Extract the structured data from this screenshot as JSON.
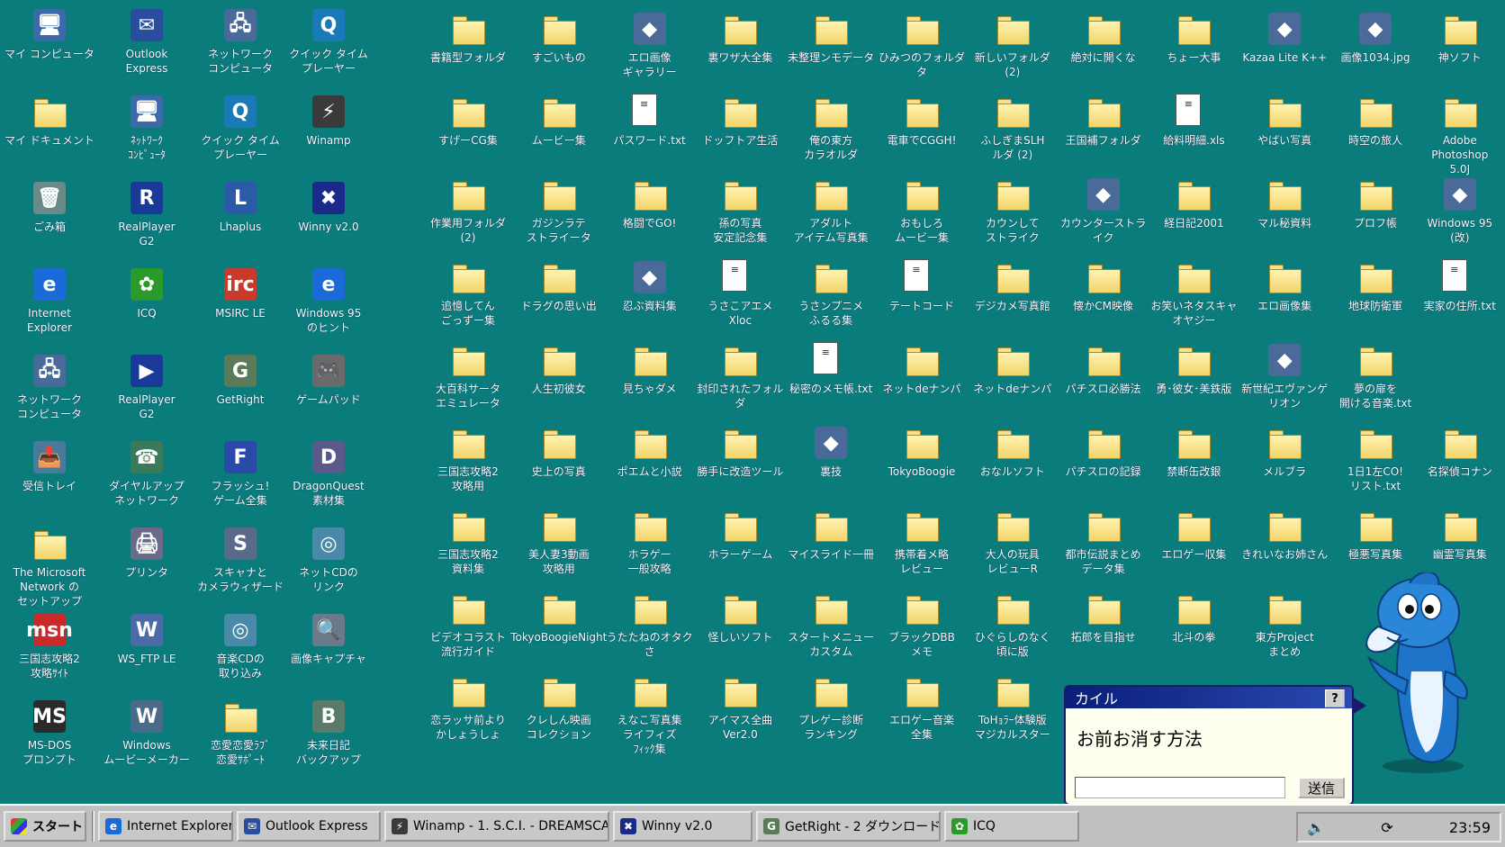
{
  "left_icons": [
    {
      "label": "マイ コンピュータ",
      "glyph": "🖥",
      "kind": "app",
      "color": "#3a6aa8"
    },
    {
      "label": "Outlook\nExpress",
      "glyph": "✉",
      "kind": "app",
      "color": "#2a4e9e"
    },
    {
      "label": "ネットワーク\nコンピュータ",
      "glyph": "🖧",
      "kind": "app",
      "color": "#4a6a9a"
    },
    {
      "label": "クイック タイム\nプレーヤー",
      "glyph": "Q",
      "kind": "app",
      "color": "#1a7ab8"
    },
    {
      "label": "マイ ドキュメント",
      "glyph": "",
      "kind": "folder"
    },
    {
      "label": "ﾈｯﾄﾜｰｸ\nｺﾝﾋﾟｭｰﾀ",
      "glyph": "🖥",
      "kind": "app",
      "color": "#3a6aa8"
    },
    {
      "label": "クイック タイム\nプレーヤー",
      "glyph": "Q",
      "kind": "app",
      "color": "#1a7ab8"
    },
    {
      "label": "Winamp",
      "glyph": "⚡",
      "kind": "app",
      "color": "#3a3a3a"
    },
    {
      "label": "ごみ箱",
      "glyph": "🗑",
      "kind": "app",
      "color": "#6a8a8a"
    },
    {
      "label": "RealPlayer\nG2",
      "glyph": "R",
      "kind": "app",
      "color": "#1a3a9a"
    },
    {
      "label": "Lhaplus",
      "glyph": "L",
      "kind": "app",
      "color": "#2a5aa8"
    },
    {
      "label": "Winny v2.0",
      "glyph": "✖",
      "kind": "app",
      "color": "#1a2a8a"
    },
    {
      "label": "Internet\nExplorer",
      "glyph": "e",
      "kind": "app",
      "color": "#1a6ad8"
    },
    {
      "label": "ICQ",
      "glyph": "✿",
      "kind": "app",
      "color": "#2a9a2a"
    },
    {
      "label": "MSIRC LE",
      "glyph": "irc",
      "kind": "app",
      "color": "#c83a2a"
    },
    {
      "label": "Windows 95\nのヒント",
      "glyph": "e",
      "kind": "app",
      "color": "#1a6ad8"
    },
    {
      "label": "ネットワーク\nコンピュータ",
      "glyph": "🖧",
      "kind": "app",
      "color": "#4a6a9a"
    },
    {
      "label": "RealPlayer\nG2",
      "glyph": "▶",
      "kind": "app",
      "color": "#1a3a9a"
    },
    {
      "label": "GetRight",
      "glyph": "G",
      "kind": "app",
      "color": "#5a7a5a"
    },
    {
      "label": "ゲームパッド",
      "glyph": "🎮",
      "kind": "app",
      "color": "#6a6a6a"
    },
    {
      "label": "受信トレイ",
      "glyph": "📥",
      "kind": "app",
      "color": "#4a7a9a"
    },
    {
      "label": "ダイヤルアップ\nネットワーク",
      "glyph": "☎",
      "kind": "app",
      "color": "#3a7a5a"
    },
    {
      "label": "フラッシュ!\nゲーム全集",
      "glyph": "F",
      "kind": "app",
      "color": "#2a4aa8"
    },
    {
      "label": "DragonQuest\n素材集",
      "glyph": "D",
      "kind": "app",
      "color": "#5a5a8a"
    },
    {
      "label": "The Microsoft\nNetwork の\nセットアップ",
      "glyph": "",
      "kind": "folder"
    },
    {
      "label": "プリンタ",
      "glyph": "🖨",
      "kind": "app",
      "color": "#6a6a8a"
    },
    {
      "label": "スキャナと\nカメラウィザード",
      "glyph": "S",
      "kind": "app",
      "color": "#5a6a8a"
    },
    {
      "label": "ネットCDの\nリンク",
      "glyph": "◎",
      "kind": "app",
      "color": "#4a8aa8"
    },
    {
      "label": "三国志攻略2\n攻略ｻｲﾄ",
      "glyph": "msn",
      "kind": "app",
      "color": "#c82a2a"
    },
    {
      "label": "WS_FTP LE",
      "glyph": "W",
      "kind": "app",
      "color": "#4a6aa8"
    },
    {
      "label": "音楽CDの\n取り込み",
      "glyph": "◎",
      "kind": "app",
      "color": "#4a8aa8"
    },
    {
      "label": "画像キャプチャ",
      "glyph": "🔍",
      "kind": "app",
      "color": "#6a7a8a"
    },
    {
      "label": "MS-DOS\nプロンプト",
      "glyph": "MS",
      "kind": "app",
      "color": "#2a2a2a"
    },
    {
      "label": "Windows\nムービーメーカー",
      "glyph": "W",
      "kind": "app",
      "color": "#4a6a8a"
    },
    {
      "label": "恋愛恋愛ﾗﾌﾞ\n恋愛ｻﾎﾟｰﾄ",
      "glyph": "",
      "kind": "folder"
    },
    {
      "label": "未来日記\nバックアップ",
      "glyph": "B",
      "kind": "app",
      "color": "#5a7a6a"
    }
  ],
  "grid_icons": [
    [
      "書籍型フォルダ",
      "すごいもの",
      "エロ画像\nギャラリー",
      "裏ワザ大全集",
      "未整理ンモデータ",
      "ひみつのフォルダ\nタ",
      "新しいフォルダ\n(2)",
      "絶対に開くな",
      "ちょー大事",
      "Kazaa Lite K++",
      "画像1034.jpg",
      "神ソフト"
    ],
    [
      "すげーCG集",
      "ムービー集",
      "パスワード.txt",
      "ドッフトア生活",
      "俺の東方\nカラオルダ",
      "電車でCGGH!",
      "ふしぎまSLH\nルダ (2)",
      "王国補フォルダ",
      "給料明細.xls",
      "やばい写真",
      "時空の旅人",
      "Adobe\nPhotoshop 5.0J"
    ],
    [
      "作業用フォルダ\n(2)",
      "ガジンラテ\nストライータ",
      "格闘でGO!",
      "孫の写真\n安定記念集",
      "アダルト\nアイテム写真集",
      "おもしろ\nムービー集",
      "カウンして\nストライク",
      "カウンターストライク",
      "経日記2001",
      "マル秘資料",
      "プロフ帳",
      "Windows 95\n(改)"
    ],
    [
      "追憶してん\nごっずー集",
      "ドラグの思い出",
      "忍ぶ資料集",
      "うさこアエメ\nXloc",
      "うさンプニメ\nふるる集",
      "テートコード",
      "デジカメ写真館",
      "懐かCM映像",
      "お笑いネタスキャ\nオヤジー",
      "エロ画像集",
      "地球防衛軍",
      "実家の住所.txt"
    ],
    [
      "大百科サータ\nエミュレータ",
      "人生初彼女",
      "見ちゃダメ",
      "封印されたフォルダ",
      "秘密のメモ帳.txt",
      "ネットdeナンパ",
      "ネットdeナンパ",
      "パチスロ必勝法",
      "勇･彼女･美鉄版",
      "新世紀エヴァンゲ\nリオン",
      "夢の扉を\n開ける音楽.txt",
      ""
    ],
    [
      "三国志攻略2\n攻略用",
      "史上の写真",
      "ポエムと小説",
      "勝手に改造ツール",
      "裏技",
      "TokyoBoogie",
      "おなルソフト",
      "パチスロの記録",
      "禁断缶改銀",
      "メルブラ",
      "1日1左CO!\nリスト.txt",
      "名探偵コナン"
    ],
    [
      "三国志攻略2\n資料集",
      "美人妻3動画\n攻略用",
      "ホラゲー\n一般攻略",
      "ホラーゲーム",
      "マイスライド一冊",
      "携帯着メ略\nレビュー",
      "大人の玩具\nレビューR",
      "都市伝説まとめ\nデータ集",
      "エロゲー収集",
      "きれいなお姉さん",
      "極悪写真集",
      "幽霊写真集"
    ],
    [
      "ビデオコラスト\n流行ガイド",
      "TokyoBoogieNight",
      "うたたねのオタクさ",
      "怪しいソフト",
      "スタートメニュー\nカスタム",
      "ブラックDBB\nメモ",
      "ひぐらしのなく\n頃に版",
      "拓郎を目指せ",
      "北斗の拳",
      "東方Project\nまとめ",
      "",
      ""
    ],
    [
      "恋ラッサ前より\nかしょうしょ",
      "クレしん映画\nコレクション",
      "えなこ写真集\nライフィズ\nﾌｨｯｸ集",
      "アイマス全曲\nVer2.0",
      "プレゲー診断\nランキング",
      "エロゲー音楽\n全集",
      "ToHｮﾗｰ体験版\nマジカルスター",
      "",
      "",
      "",
      "",
      ""
    ]
  ],
  "grid_special": {
    "エロ画像\nギャラリー": "app",
    "パスワード.txt": "file",
    "給料明細.xls": "file",
    "カウンターストライク": "app",
    "Kazaa Lite K++": "app",
    "画像1034.jpg": "app",
    "Adobe\nPhotoshop 5.0J": "folder",
    "Windows 95\n(改)": "app",
    "忍ぶ資料集": "app",
    "うさこアエメ\nXloc": "file",
    "テートコード": "file",
    "実家の住所.txt": "file",
    "秘密のメモ帳.txt": "file",
    "新世紀エヴァンゲ\nリオン": "app",
    "夢の扉を\n開ける音楽.txt": "folder",
    "裏技": "app"
  },
  "assistant": {
    "title": "カイル",
    "help": "?",
    "message": "お前お消す方法",
    "send_label": "送信"
  },
  "taskbar": {
    "start_label": "スタート",
    "buttons": [
      {
        "label": "Internet Explorer",
        "color": "#1a6ad8",
        "glyph": "e"
      },
      {
        "label": "Outlook Express",
        "color": "#2a4e9e",
        "glyph": "✉"
      },
      {
        "label": "Winamp - 1. S.C.I. - DREAMSCAPE",
        "color": "#3a3a3a",
        "glyph": "⚡"
      },
      {
        "label": "Winny v2.0",
        "color": "#1a2a8a",
        "glyph": "✖"
      },
      {
        "label": "GetRight - 2 ダウンロード中",
        "color": "#5a7a5a",
        "glyph": "G"
      },
      {
        "label": "ICQ",
        "color": "#2a9a2a",
        "glyph": "✿"
      }
    ],
    "clock": "23:59"
  }
}
